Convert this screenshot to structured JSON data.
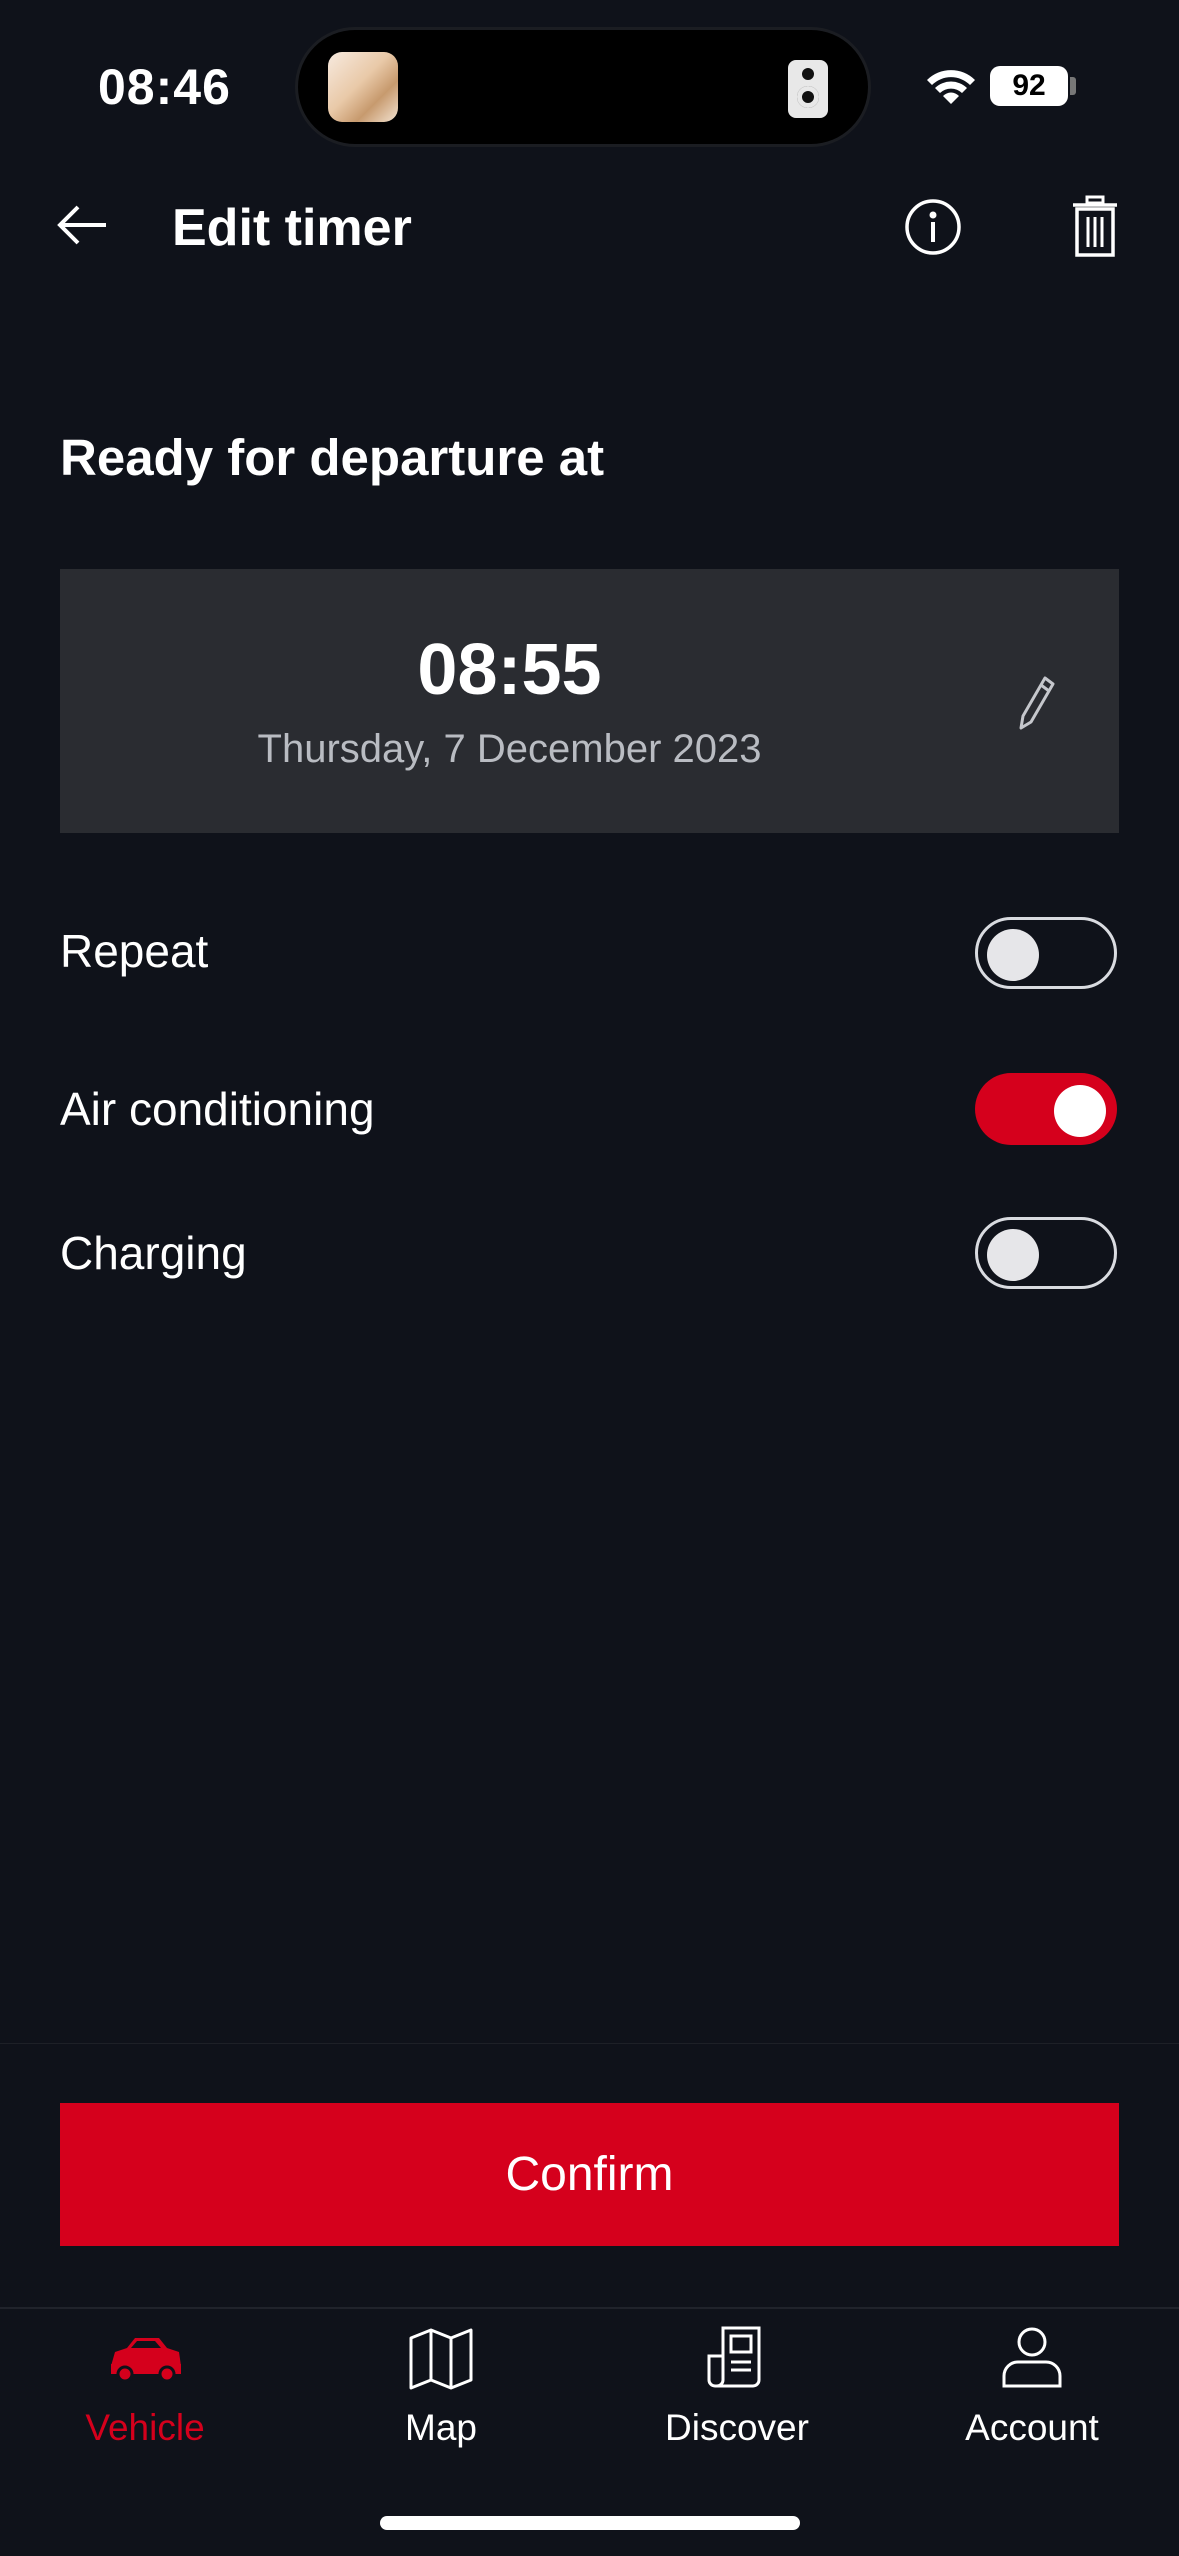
{
  "status_bar": {
    "time": "08:46",
    "battery": "92"
  },
  "header": {
    "title": "Edit timer"
  },
  "departure": {
    "section_title": "Ready for departure at",
    "time": "08:55",
    "date": "Thursday, 7 December 2023"
  },
  "settings": [
    {
      "label": "Repeat",
      "on": false
    },
    {
      "label": "Air conditioning",
      "on": true
    },
    {
      "label": "Charging",
      "on": false
    }
  ],
  "confirm_label": "Confirm",
  "nav": [
    {
      "label": "Vehicle",
      "icon": "car-icon",
      "active": true
    },
    {
      "label": "Map",
      "icon": "map-icon",
      "active": false
    },
    {
      "label": "Discover",
      "icon": "news-icon",
      "active": false
    },
    {
      "label": "Account",
      "icon": "user-icon",
      "active": false
    }
  ],
  "colors": {
    "accent": "#d5001c",
    "background": "#0f121a",
    "card": "#2a2c31"
  }
}
